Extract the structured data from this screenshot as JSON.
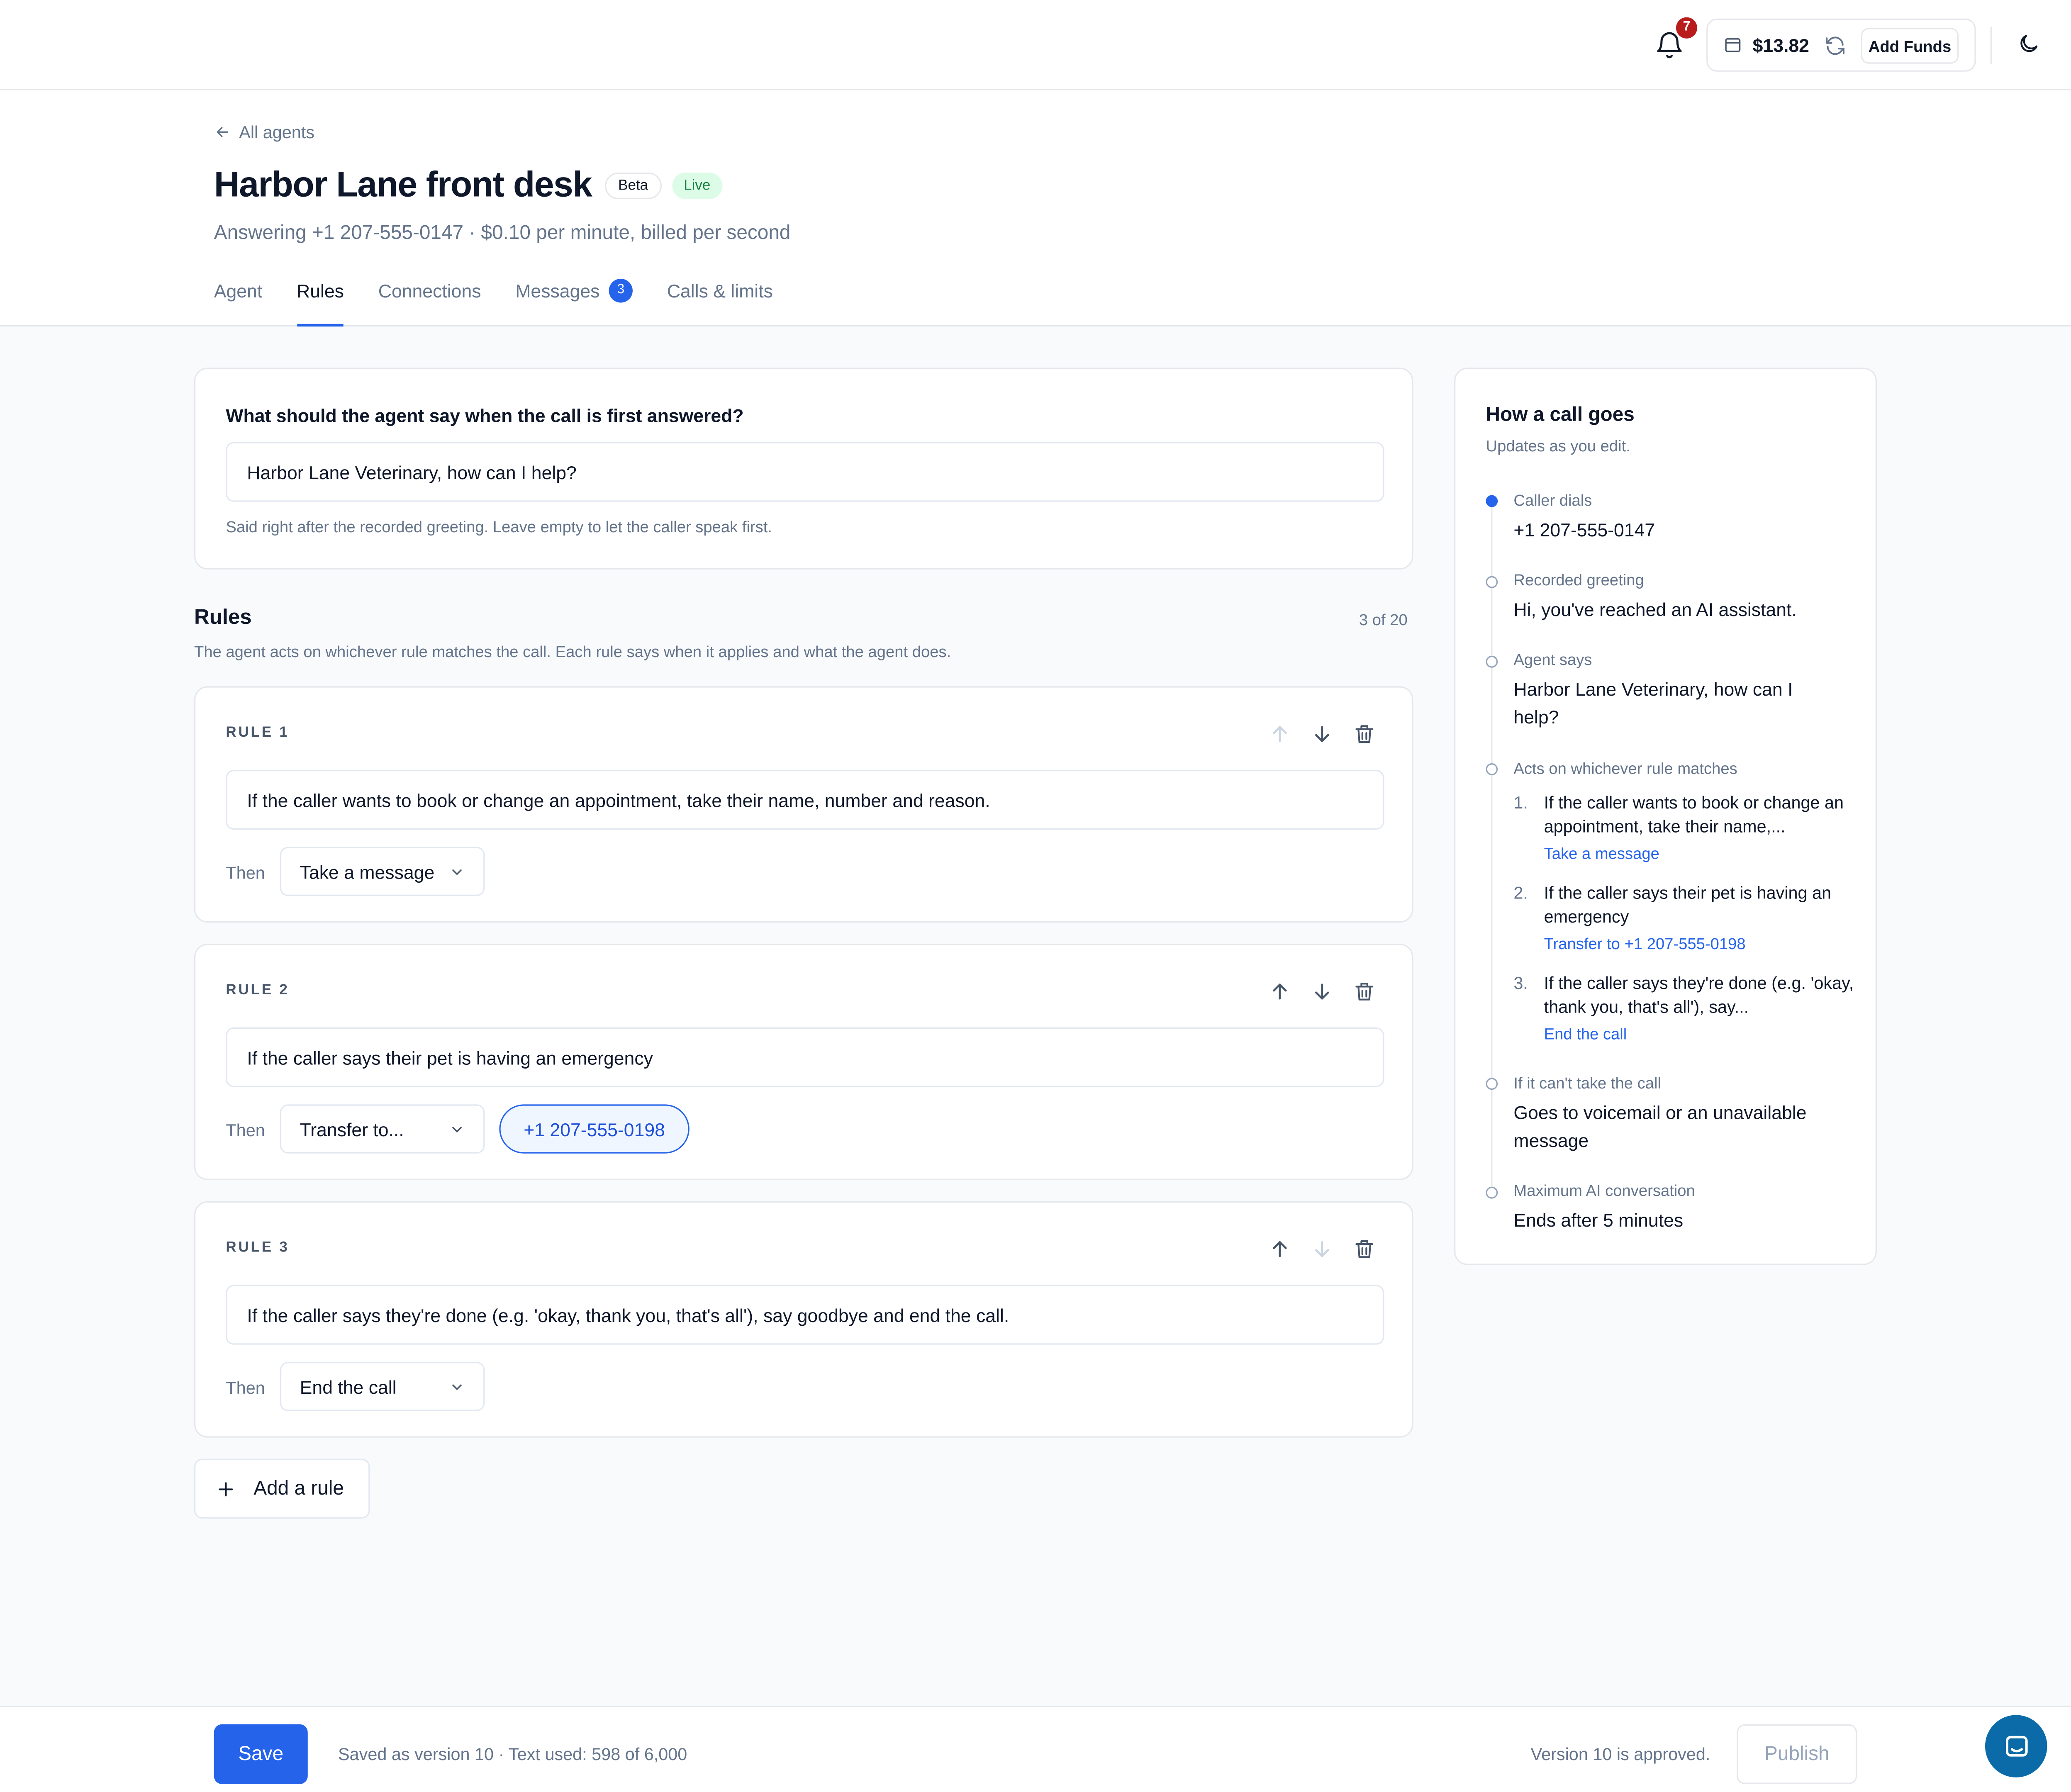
{
  "topbar": {
    "notification_count": "7",
    "balance": "$13.82",
    "add_funds_label": "Add Funds"
  },
  "header": {
    "back_label": "All agents",
    "title": "Harbor Lane front desk",
    "badge_beta": "Beta",
    "badge_live": "Live",
    "subtitle": "Answering +1 207-555-0147 · $0.10 per minute, billed per second",
    "tabs": [
      {
        "label": "Agent"
      },
      {
        "label": "Rules",
        "active": true
      },
      {
        "label": "Connections"
      },
      {
        "label": "Messages",
        "count": "3"
      },
      {
        "label": "Calls & limits"
      }
    ]
  },
  "greeting": {
    "question": "What should the agent say when the call is first answered?",
    "value": "Harbor Lane Veterinary, how can I help?",
    "hint": "Said right after the recorded greeting. Leave empty to let the caller speak first."
  },
  "rules": {
    "title": "Rules",
    "count": "3 of 20",
    "description": "The agent acts on whichever rule matches the call. Each rule says when it applies and what the agent does.",
    "then_label": "Then",
    "items": [
      {
        "label": "RULE 1",
        "condition": "If the caller wants to book or change an appointment, take their name, number and reason.",
        "action": "Take a message"
      },
      {
        "label": "RULE 2",
        "condition": "If the caller says their pet is having an emergency",
        "action": "Transfer to...",
        "transfer_number": "+1 207-555-0198"
      },
      {
        "label": "RULE 3",
        "condition": "If the caller says they're done (e.g. 'okay, thank you, that's all'), say goodbye and end the call.",
        "action": "End the call"
      }
    ],
    "add_label": "Add a rule"
  },
  "flow": {
    "title": "How a call goes",
    "subtitle": "Updates as you edit.",
    "steps": [
      {
        "label": "Caller dials",
        "value": "+1 207-555-0147"
      },
      {
        "label": "Recorded greeting",
        "value": "Hi, you've reached an AI assistant."
      },
      {
        "label": "Agent says",
        "value": "Harbor Lane Veterinary, how can I help?"
      },
      {
        "label": "Acts on whichever rule matches"
      },
      {
        "label": "If it can't take the call",
        "value": "Goes to voicemail or an unavailable message"
      },
      {
        "label": "Maximum AI conversation",
        "value": "Ends after 5 minutes"
      }
    ],
    "rule_summaries": [
      {
        "num": "1.",
        "text": "If the caller wants to book or change an appointment, take their name,...",
        "action": "Take a message"
      },
      {
        "num": "2.",
        "text": "If the caller says their pet is having an emergency",
        "action": "Transfer to +1 207-555-0198"
      },
      {
        "num": "3.",
        "text": "If the caller says they're done (e.g. 'okay, thank you, that's all'), say...",
        "action": "End the call"
      }
    ]
  },
  "footer": {
    "save_label": "Save",
    "save_status": "Saved as version 10 · Text used: 598 of 6,000",
    "approved_text": "Version 10 is approved.",
    "publish_label": "Publish"
  },
  "colors": {
    "accent": "#2563eb",
    "live_green": "#15803d",
    "notification_red": "#b91c1c",
    "chat_blue": "#0b6aa8"
  },
  "icons": [
    "bell-icon",
    "wallet-icon",
    "refresh-icon",
    "moon-icon",
    "arrow-left-icon",
    "arrow-up-icon",
    "arrow-down-icon",
    "trash-icon",
    "chevron-down-icon",
    "plus-icon",
    "chat-icon"
  ]
}
